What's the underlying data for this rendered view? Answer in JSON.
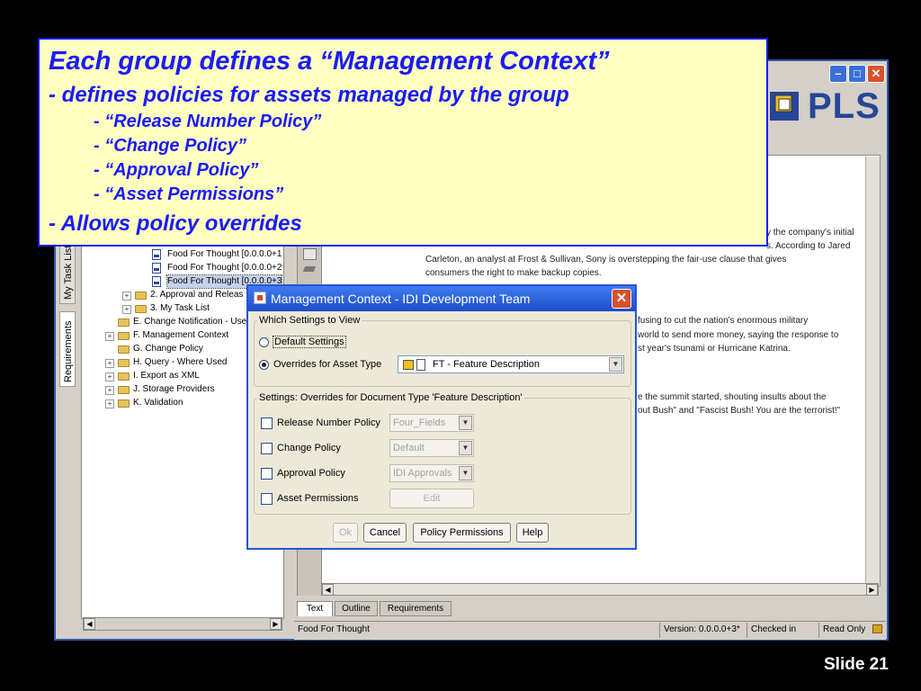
{
  "callout": {
    "line1": "Each group defines a “Management Context”",
    "line2": "- defines policies for assets managed by the group",
    "items": [
      "- “Release Number Policy”",
      "- “Change Policy”",
      "- “Approval Policy”",
      "- “Asset Permissions”"
    ],
    "line3": "- Allows policy overrides"
  },
  "app": {
    "logo": "PLS",
    "vertical_tabs": [
      "My Task List",
      "Requirements"
    ],
    "tree": [
      {
        "label": "Food For Thought [0.0.0.0+1",
        "type": "doc"
      },
      {
        "label": "Food For Thought [0.0.0.0+2",
        "type": "doc"
      },
      {
        "label": "Food For Thought [0.0.0.0+3",
        "type": "doc"
      },
      {
        "label": "2. Approval and Releas",
        "type": "folder"
      },
      {
        "label": "3. My Task List",
        "type": "folder"
      },
      {
        "label": "E. Change Notification - Use",
        "type": "folder"
      },
      {
        "label": "F. Management Context",
        "type": "folder"
      },
      {
        "label": "G. Change Policy",
        "type": "folder"
      },
      {
        "label": "H. Query - Where Used",
        "type": "folder"
      },
      {
        "label": "I. Export as XML",
        "type": "folder"
      },
      {
        "label": "J. Storage Providers",
        "type": "folder"
      },
      {
        "label": "K. Validation",
        "type": "folder"
      }
    ],
    "document_text": {
      "frag1": "y the company's initial",
      "frag2": "s. According to Jared",
      "line3": "Carleton, an analyst at Frost & Sullivan, Sony is overstepping the fair-use clause that gives",
      "line4": "consumers the right to make backup copies.",
      "frag5": "fusing to cut the nation's enormous military",
      "frag6": "world to send more money, saying the response to",
      "frag7": "st year's tsunami or Hurricane Katrina.",
      "frag8": "e the summit started, shouting insults about the",
      "frag9": "out Bush\" and \"Fascist Bush! You are the terrorist!\""
    },
    "bottom_tabs": [
      "Text",
      "Outline",
      "Requirements"
    ],
    "status": {
      "doc_name": "Food For Thought",
      "version": "Version: 0.0.0.0+3*",
      "checked": "Checked in",
      "read_only": "Read Only"
    }
  },
  "dialog": {
    "title": "Management Context - IDI Development Team",
    "group1_legend": "Which Settings to View",
    "radio_default": "Default Settings",
    "radio_overrides": "Overrides for Asset Type",
    "asset_type_value": "FT - Feature Description",
    "group2_legend": "Settings: Overrides for Document Type 'Feature Description'",
    "settings": [
      {
        "label": "Release Number Policy",
        "value": "Four_Fields"
      },
      {
        "label": "Change Policy",
        "value": "Default"
      },
      {
        "label": "Approval Policy",
        "value": "IDI Approvals"
      }
    ],
    "asset_permissions_label": "Asset Permissions",
    "edit_label": "Edit",
    "buttons": {
      "ok": "Ok",
      "cancel": "Cancel",
      "policy_permissions": "Policy Permissions",
      "help": "Help"
    }
  },
  "slide_number": "Slide 21"
}
